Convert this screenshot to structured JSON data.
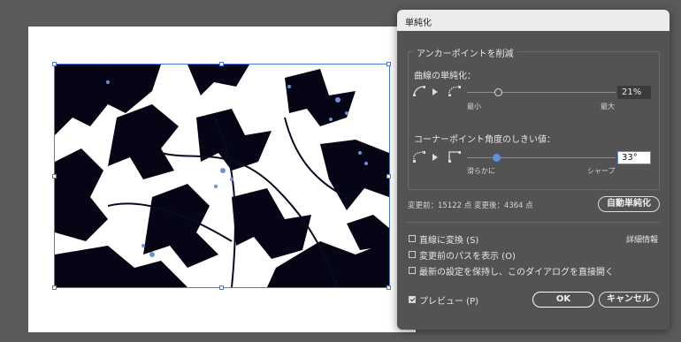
{
  "dialog": {
    "title": "単純化",
    "reduce_anchor_group": {
      "legend": "アンカーポイントを削減",
      "curve_label": "曲線の単純化：",
      "curve_min_label": "最小",
      "curve_max_label": "最大",
      "curve_value": "21%",
      "curve_level": 0.21,
      "corner_label": "コーナーポイント角度のしきい値：",
      "corner_min_label": "滑らかに",
      "corner_max_label": "シャープ",
      "corner_value": "33°",
      "corner_level": 0.2
    },
    "point_count_text": "変更前：15122 点 変更後：4364 点",
    "auto_simplify_button": "自動単純化",
    "options": {
      "convert_to_straight": {
        "label": "直線に変換 (S)",
        "checked": false
      },
      "show_original_path": {
        "label": "変更前のパスを表示 (O)",
        "checked": false
      },
      "keep_latest_settings": {
        "label": "最新の設定を保持し、このダイアログを直接開く",
        "checked": false
      }
    },
    "details_link": "詳細情報",
    "preview": {
      "label": "プレビュー (P)",
      "checked": true
    },
    "ok_button": "OK",
    "cancel_button": "キャンセル"
  },
  "colors": {
    "canvas_bg": "#595b5a",
    "dialog_bg": "#535353",
    "accent": "#5b8fe0",
    "selection": "#4a7bd6"
  },
  "icons": [
    "curve-min-icon",
    "curve-max-icon",
    "corner-smooth-icon",
    "corner-sharp-icon",
    "arrow-right-icon",
    "checkbox-icon"
  ]
}
